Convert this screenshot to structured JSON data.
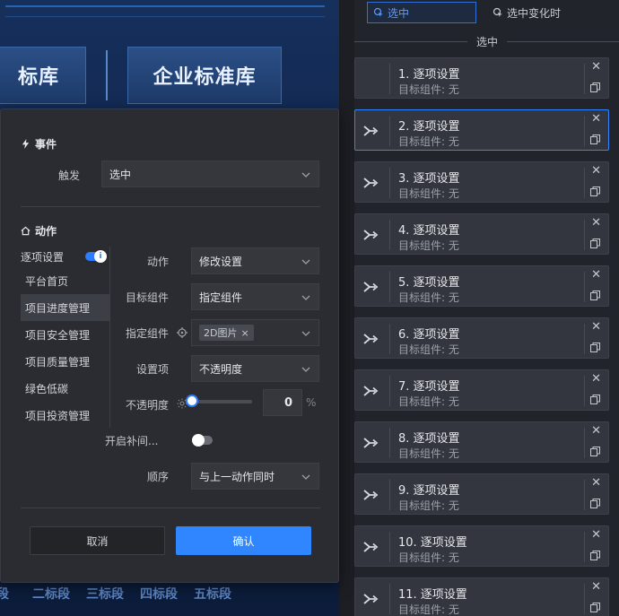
{
  "canvas": {
    "buttons": [
      "标库",
      "企业标准库"
    ],
    "segments": [
      "段",
      "二标段",
      "三标段",
      "四标段",
      "五标段"
    ]
  },
  "right_panel": {
    "tabs": [
      {
        "label": "选中",
        "active": true
      },
      {
        "label": "选中变化时",
        "active": false
      }
    ],
    "section_label": "选中",
    "cards": [
      {
        "title": "1. 逐项设置",
        "sub": "目标组件: 无",
        "has_arrow": false,
        "active": false
      },
      {
        "title": "2. 逐项设置",
        "sub": "目标组件: 无",
        "has_arrow": true,
        "active": true
      },
      {
        "title": "3. 逐项设置",
        "sub": "目标组件: 无",
        "has_arrow": true,
        "active": false
      },
      {
        "title": "4. 逐项设置",
        "sub": "目标组件: 无",
        "has_arrow": true,
        "active": false
      },
      {
        "title": "5. 逐项设置",
        "sub": "目标组件: 无",
        "has_arrow": true,
        "active": false
      },
      {
        "title": "6. 逐项设置",
        "sub": "目标组件: 无",
        "has_arrow": true,
        "active": false
      },
      {
        "title": "7. 逐项设置",
        "sub": "目标组件: 无",
        "has_arrow": true,
        "active": false
      },
      {
        "title": "8. 逐项设置",
        "sub": "目标组件: 无",
        "has_arrow": true,
        "active": false
      },
      {
        "title": "9. 逐项设置",
        "sub": "目标组件: 无",
        "has_arrow": true,
        "active": false
      },
      {
        "title": "10. 逐项设置",
        "sub": "目标组件: 无",
        "has_arrow": true,
        "active": false
      },
      {
        "title": "11. 逐项设置",
        "sub": "目标组件: 无",
        "has_arrow": true,
        "active": false
      }
    ]
  },
  "dialog": {
    "event_section": "事件",
    "trigger_label": "触发",
    "trigger_value": "选中",
    "action_section": "动作",
    "list_title": "逐项设置",
    "list_items": [
      "平台首页",
      "项目进度管理",
      "项目安全管理",
      "项目质量管理",
      "绿色低碳",
      "项目投资管理"
    ],
    "active_item": 1,
    "action_label": "动作",
    "action_value": "修改设置",
    "target_label": "目标组件",
    "target_value": "指定组件",
    "specify_label": "指定组件",
    "specify_tag": "2D图片",
    "setting_label": "设置项",
    "setting_value": "不透明度",
    "opacity_label": "不透明度",
    "opacity_value": "0",
    "opacity_unit": "%",
    "tween_label": "开启补间...",
    "order_label": "顺序",
    "order_value": "与上一动作同时",
    "cancel_label": "取消",
    "confirm_label": "确认",
    "accent_color": "#2f86ff"
  }
}
